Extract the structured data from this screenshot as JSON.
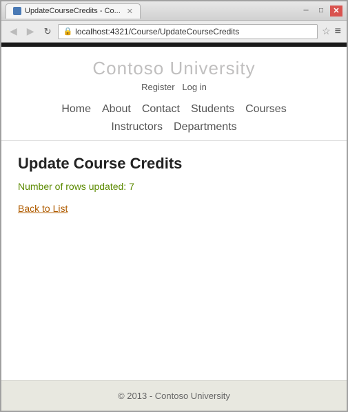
{
  "browser": {
    "tab_title": "UpdateCourseCredits - Co...",
    "tab_icon": "page-icon",
    "url": "localhost:4321/Course/UpdateCourseCredits",
    "back_label": "◀",
    "forward_label": "▶",
    "reload_label": "↻",
    "star_label": "☆",
    "menu_label": "≡",
    "minimize_label": "─",
    "maximize_label": "□",
    "close_label": "✕"
  },
  "site": {
    "title": "Contoso University",
    "auth": {
      "register": "Register",
      "login": "Log in"
    },
    "nav": {
      "row1": [
        "Home",
        "About",
        "Contact",
        "Students",
        "Courses"
      ],
      "row2": [
        "Instructors",
        "Departments"
      ]
    }
  },
  "page": {
    "title": "Update Course Credits",
    "rows_updated_label": "Number of rows updated: 7",
    "back_to_list": "Back to List"
  },
  "footer": {
    "copyright": "© 2013 - Contoso University"
  }
}
